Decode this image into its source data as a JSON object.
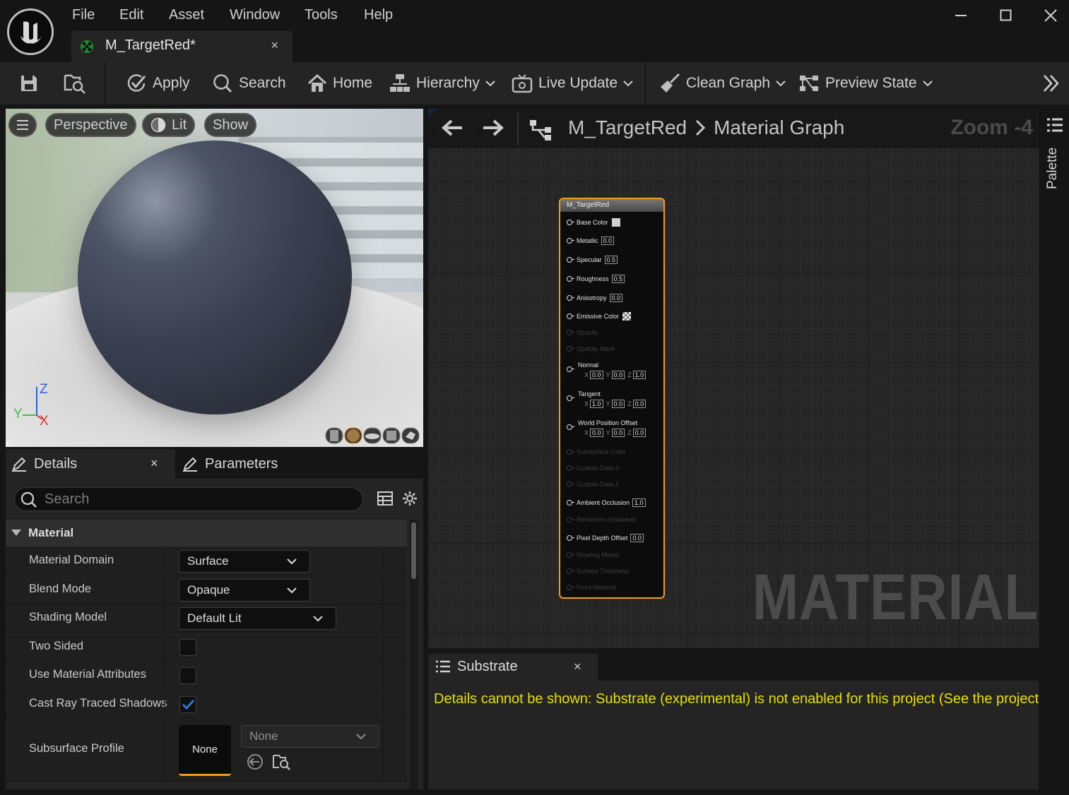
{
  "menu": {
    "file": "File",
    "edit": "Edit",
    "asset": "Asset",
    "window": "Window",
    "tools": "Tools",
    "help": "Help"
  },
  "doc_tab": {
    "name": "M_TargetRed*",
    "close": "×"
  },
  "toolbar": {
    "apply": "Apply",
    "search": "Search",
    "home": "Home",
    "hierarchy": "Hierarchy",
    "live_update": "Live Update",
    "clean_graph": "Clean Graph",
    "preview_state": "Preview State"
  },
  "viewport": {
    "perspective": "Perspective",
    "lit": "Lit",
    "show": "Show",
    "axis_z": "Z",
    "axis_y": "Y",
    "axis_x": "X"
  },
  "details": {
    "tab_details": "Details",
    "tab_close": "×",
    "tab_parameters": "Parameters",
    "search_placeholder": "Search",
    "category": "Material",
    "rows": [
      {
        "label": "Material Domain",
        "value": "Surface"
      },
      {
        "label": "Blend Mode",
        "value": "Opaque"
      },
      {
        "label": "Shading Model",
        "value": "Default Lit"
      },
      {
        "label": "Two Sided",
        "checked": false
      },
      {
        "label": "Use Material Attributes",
        "checked": false
      },
      {
        "label": "Cast Ray Traced Shadows",
        "checked": true
      },
      {
        "label": "Subsurface Profile",
        "thumb": "None",
        "value": "None"
      }
    ]
  },
  "graph": {
    "crumb_asset": "M_TargetRed",
    "crumb_graph": "Material Graph",
    "zoom": "Zoom -4",
    "watermark": "MATERIAL",
    "node": {
      "title": "M_TargetRed",
      "base_color": "Base Color",
      "metallic": "Metallic",
      "metallic_val": "0.0",
      "specular": "Specular",
      "specular_val": "0.5",
      "roughness": "Roughness",
      "roughness_val": "0.5",
      "anisotropy": "Anisotropy",
      "anisotropy_val": "0.0",
      "emissive": "Emissive Color",
      "opacity": "Opacity",
      "opacity_mask": "Opacity Mask",
      "normal": "Normal",
      "normal_x": "0.0",
      "normal_y": "0.0",
      "normal_z": "1.0",
      "tangent": "Tangent",
      "tangent_x": "1.0",
      "tangent_y": "0.0",
      "tangent_z": "0.0",
      "wpo": "World Position Offset",
      "wpo_x": "0.0",
      "wpo_y": "0.0",
      "wpo_z": "0.0",
      "subsurface": "Subsurface Color",
      "custom0": "Custom Data 0",
      "custom1": "Custom Data 1",
      "ao": "Ambient Occlusion",
      "ao_val": "1.0",
      "refraction": "Refraction (Disabled)",
      "pdo": "Pixel Depth Offset",
      "pdo_val": "0.0",
      "shading_model": "Shading Model",
      "surface_thickness": "Surface Thickness",
      "front_material": "Front Material",
      "lbl_x": "X",
      "lbl_y": "Y",
      "lbl_z": "Z"
    }
  },
  "palette": {
    "label": "Palette"
  },
  "substrate": {
    "tab": "Substrate",
    "close": "×",
    "message": "Details cannot be shown: Substrate (experimental) is not enabled for this project (See the project"
  },
  "colors": {
    "accent_orange": "#f29a1e",
    "message_yellow": "#e5e000",
    "checkbox_blue": "#2a7ad5"
  }
}
